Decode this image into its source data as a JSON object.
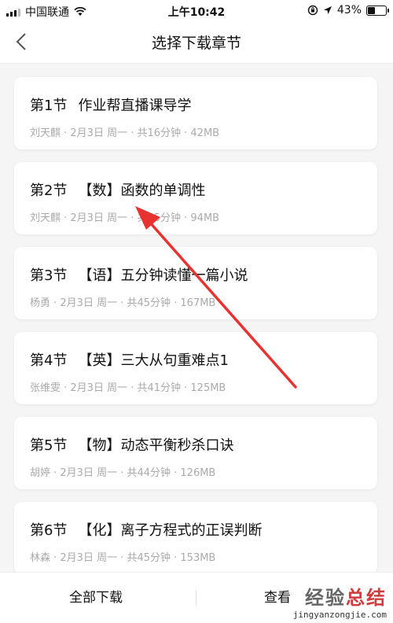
{
  "status_bar": {
    "carrier": "中国联通",
    "time": "上午10:42",
    "battery": "43%",
    "battery_level": 0.43
  },
  "nav": {
    "title": "选择下载章节"
  },
  "chapters": [
    {
      "num": "第1节",
      "title": "作业帮直播课导学",
      "meta": "刘天麒 · 2月3日 周一 · 共16分钟 · 42MB"
    },
    {
      "num": "第2节",
      "title": "【数】函数的单调性",
      "meta": "刘天麒 · 2月3日 周一 · 共45分钟 · 94MB"
    },
    {
      "num": "第3节",
      "title": "【语】五分钟读懂一篇小说",
      "meta": "杨勇 · 2月3日 周一 · 共45分钟 · 167MB"
    },
    {
      "num": "第4节",
      "title": "【英】三大从句重难点1",
      "meta": "张维雯 · 2月3日 周一 · 共41分钟 · 125MB"
    },
    {
      "num": "第5节",
      "title": "【物】动态平衡秒杀口诀",
      "meta": "胡婷 · 2月3日 周一 · 共44分钟 · 126MB"
    },
    {
      "num": "第6节",
      "title": "【化】离子方程式的正误判断",
      "meta": "林森 · 2月3日 周一 · 共45分钟 · 153MB"
    }
  ],
  "bottom": {
    "download_all": "全部下载",
    "view": "查看"
  },
  "watermark": {
    "brand_gray": "经验",
    "brand_red": "总结",
    "url": "jingyanzongjie.com"
  },
  "colors": {
    "arrow": "#e8322f",
    "background": "#f5f5f5"
  }
}
